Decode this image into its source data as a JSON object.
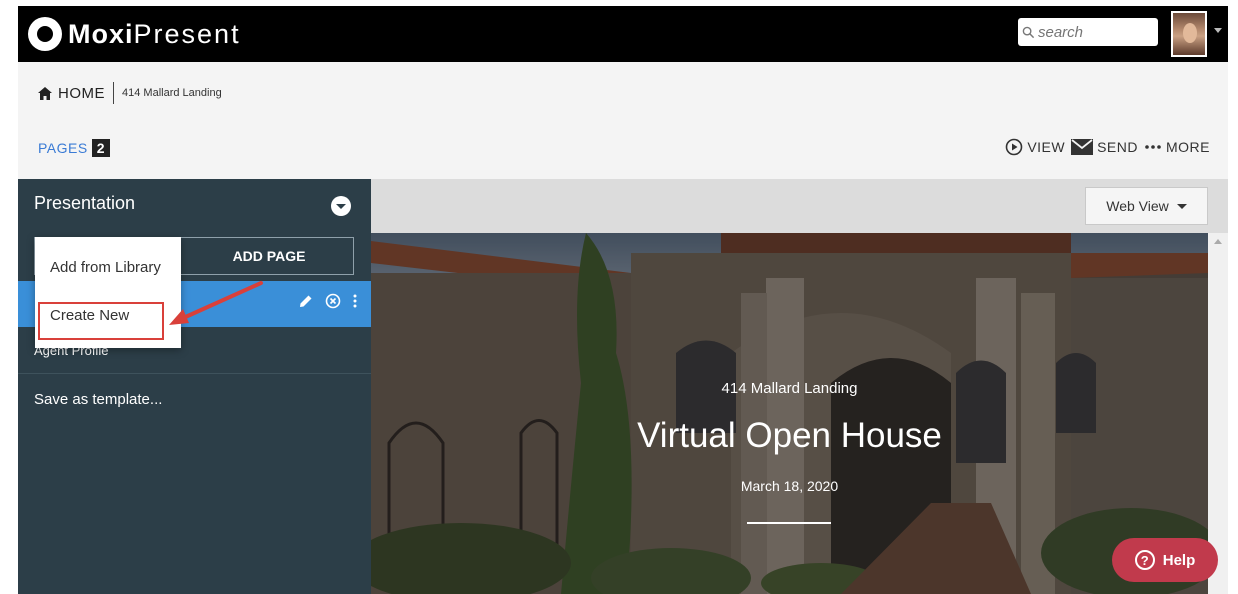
{
  "app": {
    "logo_bold": "Moxi",
    "logo_light": "Present"
  },
  "search": {
    "placeholder": "search"
  },
  "breadcrumb": {
    "home": "HOME",
    "current": "414 Mallard Landing"
  },
  "pages": {
    "label": "PAGES",
    "count": "2"
  },
  "actions": {
    "view": "VIEW",
    "send": "SEND",
    "more": "MORE"
  },
  "sidebar": {
    "title": "Presentation",
    "add_page": "ADD PAGE",
    "items": [
      "Agent Profile"
    ],
    "save_template": "Save as template..."
  },
  "dropdown": {
    "items": [
      "Add from Library",
      "Create New"
    ]
  },
  "view_mode": {
    "selected": "Web View"
  },
  "hero": {
    "address": "414 Mallard Landing",
    "title": "Virtual Open House",
    "date": "March 18, 2020"
  },
  "help": {
    "label": "Help"
  },
  "colors": {
    "accent_blue": "#3a8fd8",
    "sidebar_bg": "#2c3e48",
    "help_red": "#c13a4c",
    "highlight_red": "#d9403a"
  }
}
